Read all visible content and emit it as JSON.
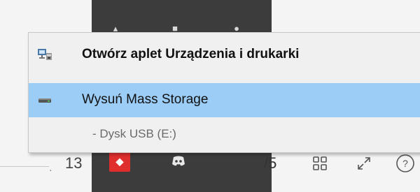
{
  "menu": {
    "items": [
      {
        "label": "Otwórz aplet Urządzenia i drukarki",
        "icon": "devices-printers-icon",
        "bold": true,
        "highlighted": false
      },
      {
        "label": "Wysuń Mass Storage",
        "icon": "usb-drive-icon",
        "highlighted": true
      },
      {
        "label": "- Dysk USB (E:)",
        "icon": "",
        "highlighted": false
      }
    ]
  },
  "toolbar": {
    "zoom_partial": "13",
    "page_partial": "/5",
    "icons": [
      "grid-view-icon",
      "expand-icon",
      "help-icon"
    ]
  },
  "tray": {
    "apps": [
      "red-app-icon",
      "discord-icon"
    ]
  },
  "colors": {
    "menu_bg": "#f0f0f0",
    "highlight": "#9ccdf6",
    "tray_bg": "#3c3c3c",
    "red_app": "#e02e2e"
  }
}
